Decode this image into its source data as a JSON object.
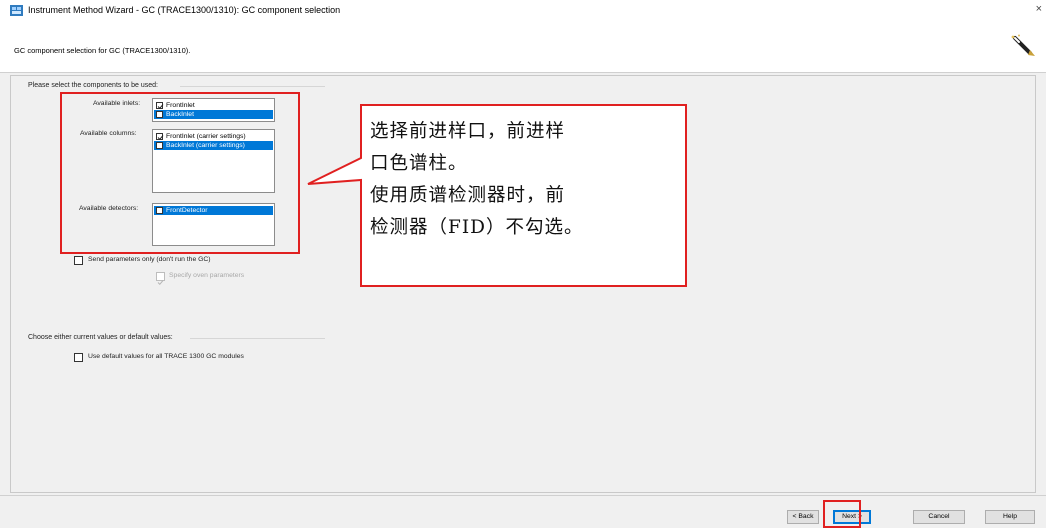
{
  "window": {
    "title": "Instrument Method Wizard - GC (TRACE1300/1310): GC component selection",
    "close_glyph": "×"
  },
  "header": {
    "subtitle": "GC component selection for GC (TRACE1300/1310)."
  },
  "components_group": {
    "title": "Please select the components to be used:",
    "inlets": {
      "label": "Available inlets:",
      "items": [
        {
          "label": "FrontInlet",
          "checked": true,
          "selected": false
        },
        {
          "label": "BackInlet",
          "checked": false,
          "selected": true
        }
      ]
    },
    "columns": {
      "label": "Available columns:",
      "items": [
        {
          "label": "FrontInlet (carrier settings)",
          "checked": true,
          "selected": false
        },
        {
          "label": "BackInlet (carrier settings)",
          "checked": false,
          "selected": true
        }
      ]
    },
    "detectors": {
      "label": "Available detectors:",
      "items": [
        {
          "label": "FrontDetector",
          "checked": false,
          "selected": true
        }
      ]
    },
    "send_params_only": {
      "label": "Send parameters only (don't run the GC)",
      "checked": false
    },
    "specify_oven": {
      "label": "Specify oven parameters",
      "checked": true,
      "disabled": true
    }
  },
  "values_group": {
    "title": "Choose either current values or default values:",
    "use_default": {
      "label": "Use default values for all TRACE 1300 GC modules",
      "checked": false
    }
  },
  "annotation": {
    "lines": [
      "选择前进样口，前进样",
      "口色谱柱。",
      "使用质谱检测器时，前",
      "检测器（FID）不勾选。"
    ],
    "color": "#e02020"
  },
  "footer": {
    "back_label": "< Back",
    "next_label": "Next >",
    "cancel_label": "Cancel",
    "help_label": "Help"
  },
  "colors": {
    "selection": "#0078d7",
    "panel_bg": "#f0f0f0",
    "highlight": "#e02020"
  }
}
